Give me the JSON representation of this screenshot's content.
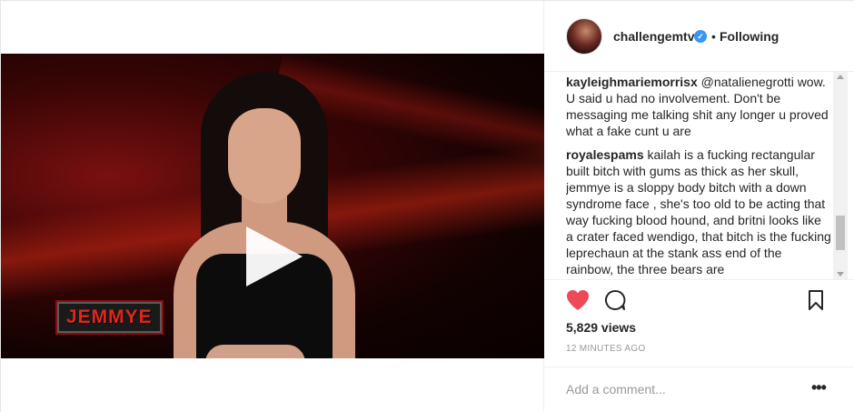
{
  "post": {
    "lower_third": "JEMMYE"
  },
  "header": {
    "username": "challengemtv",
    "verified_icon": "verified-badge-icon",
    "separator": "•",
    "follow_status": "Following"
  },
  "comments": [
    {
      "user": "kayleighmariemorrisx",
      "text": "@natalienegrotti wow. U said u had no involvement. Don't be messaging me talking shit any longer u proved what a fake cunt u are"
    },
    {
      "user": "royalespams",
      "text": "kailah is a fucking rectangular built bitch with gums as thick as her skull, jemmye is a sloppy body bitch with a down syndrome face , she's too old to be acting that way fucking blood hound, and britni looks like a crater faced wendigo, that bitch is the fucking leprechaun at the stank ass end of the rainbow, the three bears are"
    }
  ],
  "actions": {
    "like_icon": "heart-icon",
    "like_color": "#ed4956",
    "comment_icon": "speech-bubble-icon",
    "save_icon": "bookmark-icon"
  },
  "stats": {
    "views": "5,829 views",
    "timestamp": "12 MINUTES AGO"
  },
  "add_comment": {
    "placeholder": "Add a comment...",
    "more": "•••"
  }
}
